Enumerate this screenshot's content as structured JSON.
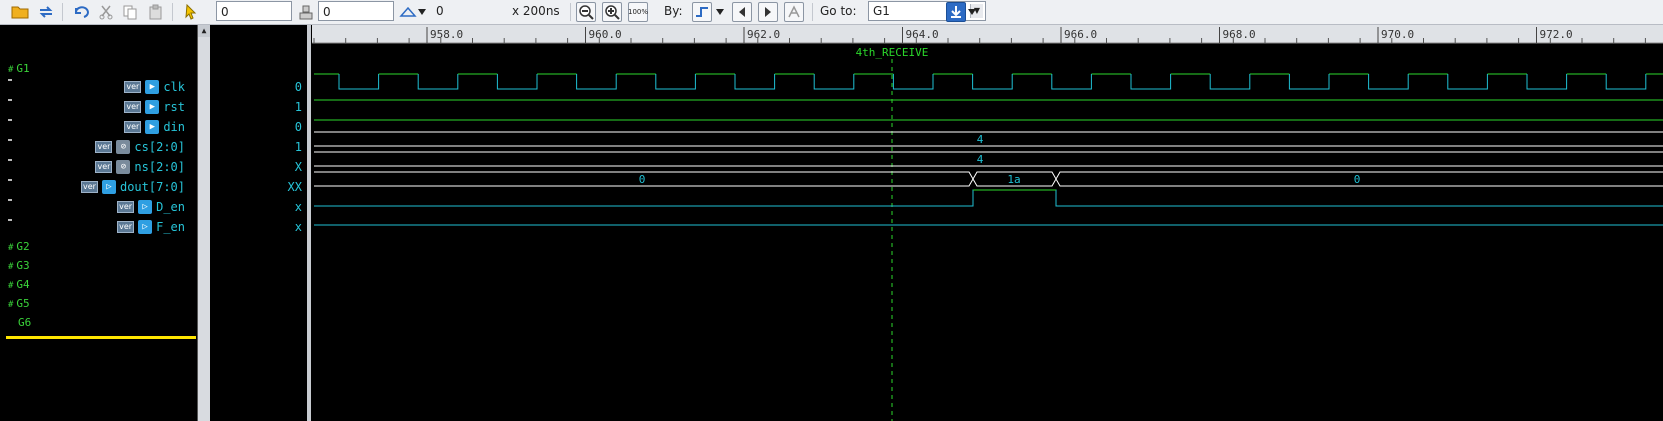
{
  "toolbar": {
    "cursor_value": "0",
    "marker_value": "0",
    "delta_value": "0",
    "scale_text": "x 200ns",
    "by_label": "By:",
    "goto_label": "Go to:",
    "goto_value": "G1",
    "zoom_full_label": "100%"
  },
  "timeline": {
    "ticks": [
      "958.0",
      "960.0",
      "962.0",
      "964.0",
      "966.0",
      "968.0",
      "970.0",
      "972.0"
    ],
    "marker_label": "4th_RECEIVE"
  },
  "groups": [
    {
      "name": "G1",
      "expanded": true
    },
    {
      "name": "G2"
    },
    {
      "name": "G3"
    },
    {
      "name": "G4"
    },
    {
      "name": "G5"
    },
    {
      "name": "G6"
    }
  ],
  "signals": [
    {
      "name": "clk",
      "badge": "ver",
      "icon": "input-port-icon",
      "value": "0"
    },
    {
      "name": "rst",
      "badge": "ver",
      "icon": "input-port-icon",
      "value": "1"
    },
    {
      "name": "din",
      "badge": "ver",
      "icon": "input-port-icon",
      "value": "0"
    },
    {
      "name": "cs[2:0]",
      "badge": "ver",
      "icon": "register-icon",
      "value": "1"
    },
    {
      "name": "ns[2:0]",
      "badge": "ver",
      "icon": "register-icon",
      "value": "X"
    },
    {
      "name": "dout[7:0]",
      "badge": "ver",
      "icon": "output-port-icon",
      "value": "XX"
    },
    {
      "name": "D_en",
      "badge": "ver",
      "icon": "output-port-icon",
      "value": "x"
    },
    {
      "name": "F_en",
      "badge": "ver",
      "icon": "output-port-icon",
      "value": "x"
    }
  ],
  "waves": {
    "cs_label": "4",
    "ns_label": "4",
    "dout_segments": [
      "0",
      "1a",
      "0"
    ]
  },
  "colors": {
    "wave_green": "#2bd82b",
    "wave_cyan": "#1fc0d4",
    "bus_white": "#ffffff",
    "marker": "#ffff00",
    "highlight": "#ffe600"
  }
}
